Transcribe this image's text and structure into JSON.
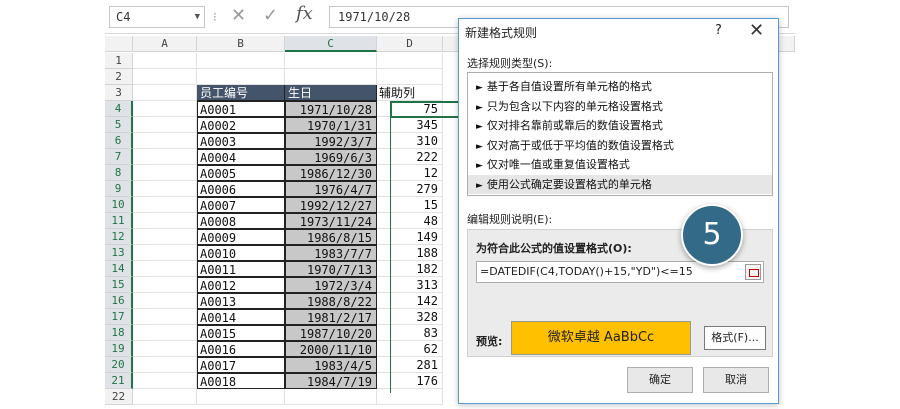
{
  "formula_bar": {
    "name_box": "C4",
    "formula": "1971/10/28",
    "sep": "⁝",
    "cancel_glyph": "✕",
    "enter_glyph": "✓",
    "fx_glyph": "fx"
  },
  "sheet": {
    "columns": [
      "A",
      "B",
      "C",
      "D"
    ],
    "rows": [
      "1",
      "2",
      "3",
      "4",
      "5",
      "6",
      "7",
      "8",
      "9",
      "10",
      "11",
      "12",
      "13",
      "14",
      "15",
      "16",
      "17",
      "18",
      "19",
      "20",
      "21",
      "22"
    ],
    "headers": {
      "b": "员工编号",
      "c": "生日",
      "d": "辅助列"
    },
    "data": [
      [
        "A0001",
        "1971/10/28",
        "75"
      ],
      [
        "A0002",
        "1970/1/31",
        "345"
      ],
      [
        "A0003",
        "1992/3/7",
        "310"
      ],
      [
        "A0004",
        "1969/6/3",
        "222"
      ],
      [
        "A0005",
        "1986/12/30",
        "12"
      ],
      [
        "A0006",
        "1976/4/7",
        "279"
      ],
      [
        "A0007",
        "1992/12/27",
        "15"
      ],
      [
        "A0008",
        "1973/11/24",
        "48"
      ],
      [
        "A0009",
        "1986/8/15",
        "149"
      ],
      [
        "A0010",
        "1983/7/7",
        "188"
      ],
      [
        "A0011",
        "1970/7/13",
        "182"
      ],
      [
        "A0012",
        "1972/3/4",
        "313"
      ],
      [
        "A0013",
        "1988/8/22",
        "142"
      ],
      [
        "A0014",
        "1981/2/17",
        "328"
      ],
      [
        "A0015",
        "1987/10/20",
        "83"
      ],
      [
        "A0016",
        "2000/11/10",
        "62"
      ],
      [
        "A0017",
        "1983/4/5",
        "281"
      ],
      [
        "A0018",
        "1984/7/19",
        "176"
      ]
    ]
  },
  "dialog": {
    "title": "新建格式规则",
    "help": "?",
    "close": "✕",
    "rule_type_label": "选择规则类型(S):",
    "rule_types": [
      "基于各自值设置所有单元格的格式",
      "只为包含以下内容的单元格设置格式",
      "仅对排名靠前或靠后的数值设置格式",
      "仅对高于或低于平均值的数值设置格式",
      "仅对唯一值或重复值设置格式",
      "使用公式确定要设置格式的单元格"
    ],
    "rule_arrow": "►",
    "selected_rule_index": 5,
    "desc_label": "编辑规则说明(E):",
    "formula_label": "为符合此公式的值设置格式(O):",
    "formula_value": "=DATEDIF(C4,TODAY()+15,\"YD\")<=15",
    "preview_label": "预览:",
    "preview_text": "微软卓越  AaBbCc",
    "preview_color": "#ffc000",
    "format_button": "格式(F)...",
    "ok_button": "确定",
    "cancel_button": "取消"
  },
  "step_badge": "5"
}
